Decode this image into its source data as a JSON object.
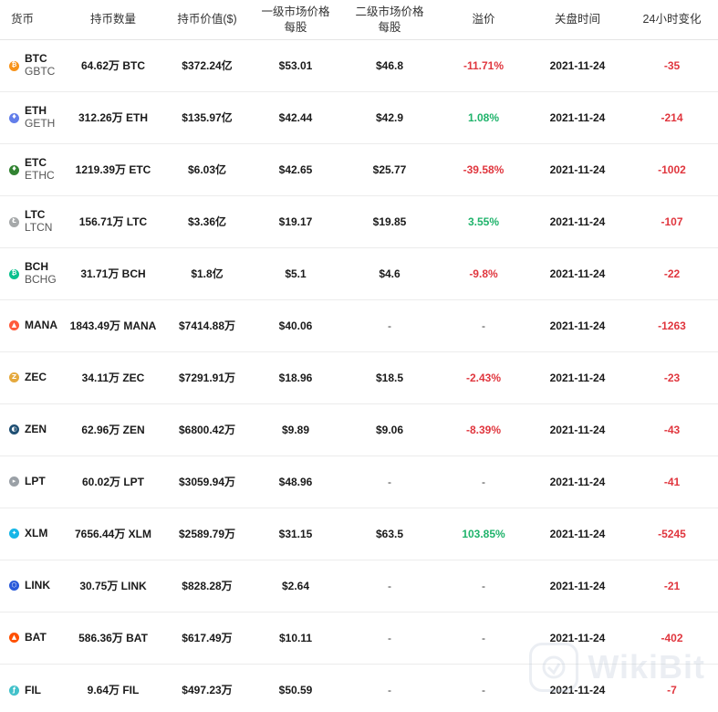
{
  "headers": {
    "coin": "货币",
    "holdings": "持币数量",
    "value": "持币价值($)",
    "primary_line1": "一级市场价格",
    "primary_line2": "每股",
    "secondary_line1": "二级市场价格",
    "secondary_line2": "每股",
    "premium": "溢价",
    "close_time": "关盘时间",
    "change_24h": "24小时变化"
  },
  "colors": {
    "positive": "#1fb36b",
    "negative": "#e0363e"
  },
  "rows": [
    {
      "symbol": "BTC",
      "trust": "GBTC",
      "icon": "bitcoin-icon",
      "icon_color": "#f7931a",
      "icon_glyph": "₿",
      "holdings": "64.62万 BTC",
      "value": "$372.24亿",
      "primary": "$53.01",
      "secondary": "$46.8",
      "premium": "-11.71%",
      "premium_sign": "neg",
      "close": "2021-11-24",
      "change": "-35"
    },
    {
      "symbol": "ETH",
      "trust": "GETH",
      "icon": "ethereum-icon",
      "icon_color": "#627eea",
      "icon_glyph": "♦",
      "holdings": "312.26万 ETH",
      "value": "$135.97亿",
      "primary": "$42.44",
      "secondary": "$42.9",
      "premium": "1.08%",
      "premium_sign": "pos",
      "close": "2021-11-24",
      "change": "-214"
    },
    {
      "symbol": "ETC",
      "trust": "ETHC",
      "icon": "ethereum-classic-icon",
      "icon_color": "#328332",
      "icon_glyph": "♦",
      "holdings": "1219.39万 ETC",
      "value": "$6.03亿",
      "primary": "$42.65",
      "secondary": "$25.77",
      "premium": "-39.58%",
      "premium_sign": "neg",
      "close": "2021-11-24",
      "change": "-1002"
    },
    {
      "symbol": "LTC",
      "trust": "LTCN",
      "icon": "litecoin-icon",
      "icon_color": "#a6a9aa",
      "icon_glyph": "Ł",
      "holdings": "156.71万 LTC",
      "value": "$3.36亿",
      "primary": "$19.17",
      "secondary": "$19.85",
      "premium": "3.55%",
      "premium_sign": "pos",
      "close": "2021-11-24",
      "change": "-107"
    },
    {
      "symbol": "BCH",
      "trust": "BCHG",
      "icon": "bitcoin-cash-icon",
      "icon_color": "#0ac18e",
      "icon_glyph": "₿",
      "holdings": "31.71万 BCH",
      "value": "$1.8亿",
      "primary": "$5.1",
      "secondary": "$4.6",
      "premium": "-9.8%",
      "premium_sign": "neg",
      "close": "2021-11-24",
      "change": "-22"
    },
    {
      "symbol": "MANA",
      "trust": "",
      "icon": "decentraland-icon",
      "icon_color": "#ff5a3c",
      "icon_glyph": "▲",
      "holdings": "1843.49万 MANA",
      "value": "$7414.88万",
      "primary": "$40.06",
      "secondary": "-",
      "premium": "-",
      "premium_sign": "dash",
      "close": "2021-11-24",
      "change": "-1263"
    },
    {
      "symbol": "ZEC",
      "trust": "",
      "icon": "zcash-icon",
      "icon_color": "#e5a93d",
      "icon_glyph": "Z",
      "holdings": "34.11万 ZEC",
      "value": "$7291.91万",
      "primary": "$18.96",
      "secondary": "$18.5",
      "premium": "-2.43%",
      "premium_sign": "neg",
      "close": "2021-11-24",
      "change": "-23"
    },
    {
      "symbol": "ZEN",
      "trust": "",
      "icon": "horizen-icon",
      "icon_color": "#1f4f73",
      "icon_glyph": "◐",
      "holdings": "62.96万 ZEN",
      "value": "$6800.42万",
      "primary": "$9.89",
      "secondary": "$9.06",
      "premium": "-8.39%",
      "premium_sign": "neg",
      "close": "2021-11-24",
      "change": "-43"
    },
    {
      "symbol": "LPT",
      "trust": "",
      "icon": "livepeer-icon",
      "icon_color": "#9aa0a6",
      "icon_glyph": "▸",
      "holdings": "60.02万 LPT",
      "value": "$3059.94万",
      "primary": "$48.96",
      "secondary": "-",
      "premium": "-",
      "premium_sign": "dash",
      "close": "2021-11-24",
      "change": "-41"
    },
    {
      "symbol": "XLM",
      "trust": "",
      "icon": "stellar-icon",
      "icon_color": "#14b6e7",
      "icon_glyph": "✦",
      "holdings": "7656.44万 XLM",
      "value": "$2589.79万",
      "primary": "$31.15",
      "secondary": "$63.5",
      "premium": "103.85%",
      "premium_sign": "pos",
      "close": "2021-11-24",
      "change": "-5245"
    },
    {
      "symbol": "LINK",
      "trust": "",
      "icon": "chainlink-icon",
      "icon_color": "#2a5ada",
      "icon_glyph": "⬡",
      "holdings": "30.75万 LINK",
      "value": "$828.28万",
      "primary": "$2.64",
      "secondary": "-",
      "premium": "-",
      "premium_sign": "dash",
      "close": "2021-11-24",
      "change": "-21"
    },
    {
      "symbol": "BAT",
      "trust": "",
      "icon": "basic-attention-token-icon",
      "icon_color": "#ff5000",
      "icon_glyph": "▲",
      "holdings": "586.36万 BAT",
      "value": "$617.49万",
      "primary": "$10.11",
      "secondary": "-",
      "premium": "-",
      "premium_sign": "dash",
      "close": "2021-11-24",
      "change": "-402"
    },
    {
      "symbol": "FIL",
      "trust": "",
      "icon": "filecoin-icon",
      "icon_color": "#42c1ca",
      "icon_glyph": "ƒ",
      "holdings": "9.64万 FIL",
      "value": "$497.23万",
      "primary": "$50.59",
      "secondary": "-",
      "premium": "-",
      "premium_sign": "dash",
      "close": "2021-11-24",
      "change": "-7"
    }
  ],
  "watermark": {
    "text": "WikiBit",
    "icon": "wikibit-logo-icon"
  }
}
